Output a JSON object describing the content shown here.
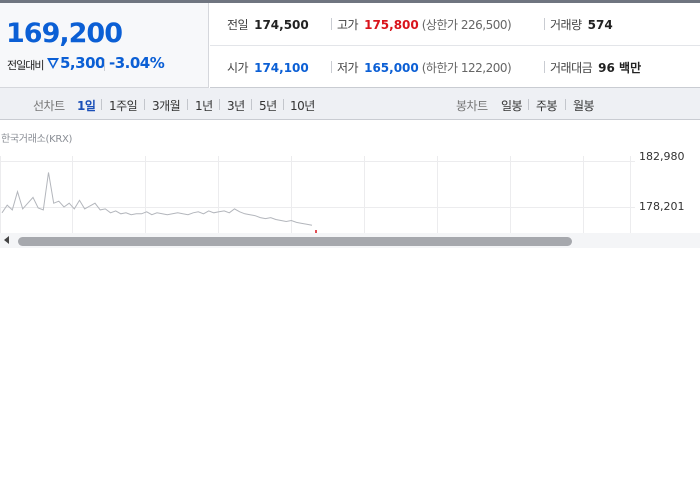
{
  "quote": {
    "price": "169,200",
    "change_label": "전일대비",
    "change_value": "5,300",
    "change_rate": "-3.04%",
    "direction": "down",
    "down_color": "#0b5fd5",
    "up_color": "#d9141c"
  },
  "stats": {
    "prev_close": {
      "label": "전일",
      "value": "174,500"
    },
    "high": {
      "label": "고가",
      "value": "175,800",
      "sub": "(상한가 226,500)"
    },
    "volume": {
      "label": "거래량",
      "value": "574"
    },
    "open": {
      "label": "시가",
      "value": "174,100"
    },
    "low": {
      "label": "저가",
      "value": "165,000",
      "sub": "(하한가 122,200)"
    },
    "turnover": {
      "label": "거래대금",
      "value": "96 백만"
    }
  },
  "tabs": {
    "line_chart_label": "선차트",
    "line_tabs": [
      "1일",
      "1주일",
      "3개월",
      "1년",
      "3년",
      "5년",
      "10년"
    ],
    "active_line_tab": "1일",
    "candle_chart_label": "봉차트",
    "candle_tabs": [
      "일봉",
      "주봉",
      "월봉"
    ]
  },
  "chart": {
    "exchange_label": "한국거래소(KRX)",
    "y_tick_labels": [
      "182,980",
      "178,201"
    ]
  },
  "chart_data": {
    "type": "line",
    "title": "",
    "xlabel": "",
    "ylabel": "",
    "y_ticks": [
      182980,
      178201
    ],
    "ylim": [
      175500,
      183500
    ],
    "grid": true,
    "series": [
      {
        "x": [
          0,
          1,
          2,
          3,
          4,
          5,
          6,
          7,
          8,
          9,
          10,
          11,
          12,
          13,
          14,
          15,
          16,
          17,
          18,
          19,
          20,
          21,
          22,
          23,
          24,
          25,
          26,
          27,
          28,
          29,
          30,
          31,
          32,
          33,
          34,
          35,
          36,
          37,
          38,
          39,
          40,
          41,
          42,
          43,
          44,
          45,
          46,
          47,
          48,
          49,
          50,
          51,
          52,
          53,
          54,
          55,
          56,
          57,
          58,
          59,
          60
        ],
        "y": [
          177600,
          178400,
          177900,
          179800,
          178000,
          178600,
          179200,
          178100,
          177900,
          181800,
          178600,
          178800,
          178200,
          178600,
          178000,
          178900,
          178000,
          178300,
          178600,
          177900,
          178000,
          177600,
          177800,
          177500,
          177600,
          177400,
          177500,
          177500,
          177700,
          177400,
          177600,
          177500,
          177400,
          177500,
          177600,
          177500,
          177400,
          177600,
          177700,
          177500,
          177800,
          177600,
          177700,
          177800,
          177600,
          178000,
          177700,
          177500,
          177400,
          177300,
          177100,
          177000,
          177100,
          176900,
          176800,
          176700,
          176800,
          176600,
          176500,
          176400,
          176300
        ],
        "color": "#b3b6bc"
      }
    ],
    "marker": {
      "color": "#d9141c"
    }
  }
}
